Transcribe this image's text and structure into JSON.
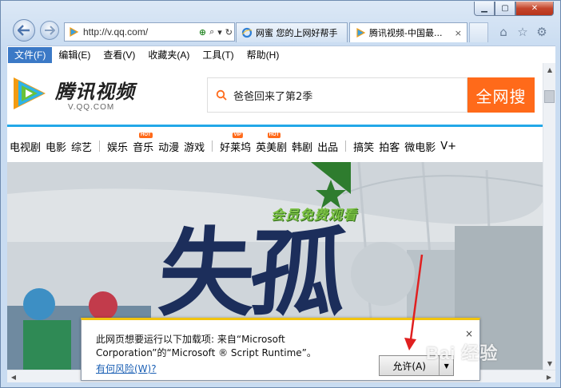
{
  "window": {
    "min_icon": "minimize-icon",
    "max_icon": "maximize-icon",
    "close_icon": "close-icon"
  },
  "address": {
    "url": "http://v.qq.com/",
    "search_glyph": "⌕",
    "dropdown_glyph": "▾",
    "refresh_glyph": "↻"
  },
  "tabs": [
    {
      "label": "网蜜 您的上网好帮手",
      "close": ""
    },
    {
      "label": "腾讯视频-中国最...",
      "close": "×"
    }
  ],
  "toolbar_icons": [
    "home-icon",
    "star-icon",
    "gear-icon"
  ],
  "menu": [
    "文件(F)",
    "编辑(E)",
    "查看(V)",
    "收藏夹(A)",
    "工具(T)",
    "帮助(H)"
  ],
  "site": {
    "logo_name": "腾讯视频",
    "logo_sub": "V.QQ.COM",
    "search_value": "爸爸回来了第2季",
    "search_button": "全网搜",
    "nav": [
      {
        "label": "电视剧"
      },
      {
        "label": "电影"
      },
      {
        "label": "综艺"
      },
      {
        "label": "娱乐",
        "sep_before": true
      },
      {
        "label": "音乐",
        "badge": "HOT"
      },
      {
        "label": "动漫"
      },
      {
        "label": "游戏"
      },
      {
        "label": "好莱坞",
        "sep_before": true,
        "badge": "VIP"
      },
      {
        "label": "英美剧",
        "badge": "HOT"
      },
      {
        "label": "韩剧"
      },
      {
        "label": "出品"
      },
      {
        "label": "搞笑",
        "sep_before": true
      },
      {
        "label": "拍客"
      },
      {
        "label": "微电影"
      },
      {
        "label": "V+"
      }
    ],
    "promo": "会员免费观看",
    "banner_title": "失孤"
  },
  "infobar": {
    "message": "此网页想要运行以下加载项: 来自“Microsoft Corporation”的“Microsoft ® Script Runtime”。",
    "risk_link": "有何风险(W)?",
    "allow_button": "允许(A)",
    "close": "×"
  },
  "watermark": "Bai 经验",
  "colors": {
    "accent": "#ff6a1a",
    "brand_blue": "#23a8e8",
    "infobar_top": "#f1c40f",
    "arrow": "#e02020"
  }
}
